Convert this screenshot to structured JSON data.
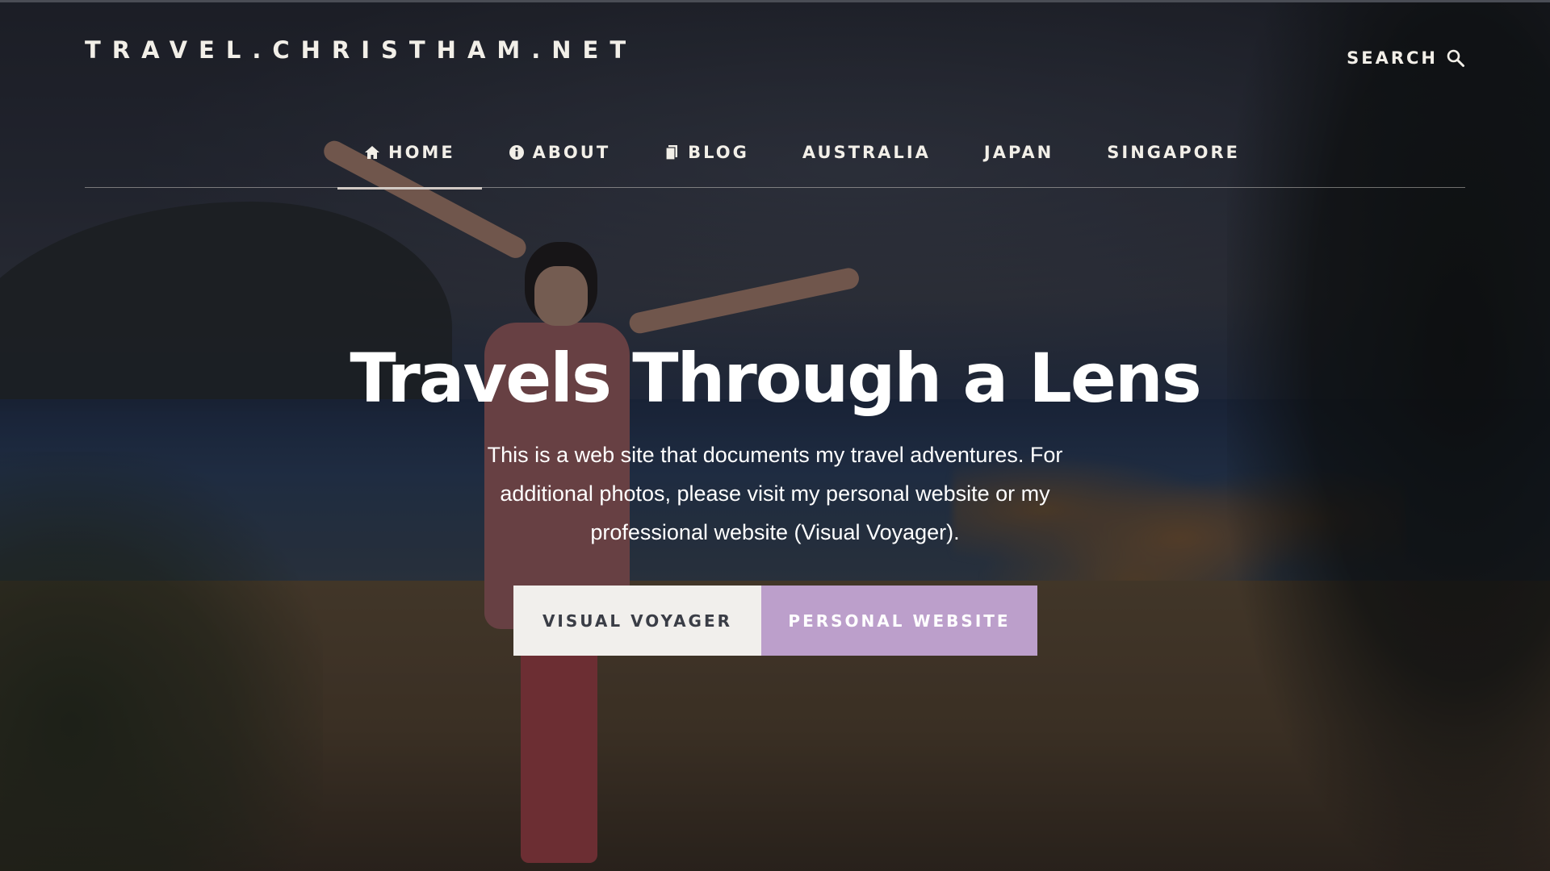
{
  "site": {
    "logo": "TRAVEL.CHRISTHAM.NET",
    "search_label": "SEARCH"
  },
  "nav": {
    "items": [
      {
        "label": "HOME",
        "icon": "home-icon"
      },
      {
        "label": "ABOUT",
        "icon": "info-icon"
      },
      {
        "label": "BLOG",
        "icon": "document-icon"
      },
      {
        "label": "AUSTRALIA"
      },
      {
        "label": "JAPAN"
      },
      {
        "label": "SINGAPORE"
      }
    ],
    "active": "HOME"
  },
  "hero": {
    "title": "Travels Through a Lens",
    "text": "This is a web site that documents my travel adventures. For additional photos, please visit my personal website or my professional website (Visual Voyager).",
    "buttons": [
      {
        "label": "VISUAL VOYAGER"
      },
      {
        "label": "PERSONAL WEBSITE"
      }
    ]
  },
  "colors": {
    "accent": "#bc9fcb",
    "light_button": "#f1efec",
    "text_light": "#f2efe8"
  }
}
